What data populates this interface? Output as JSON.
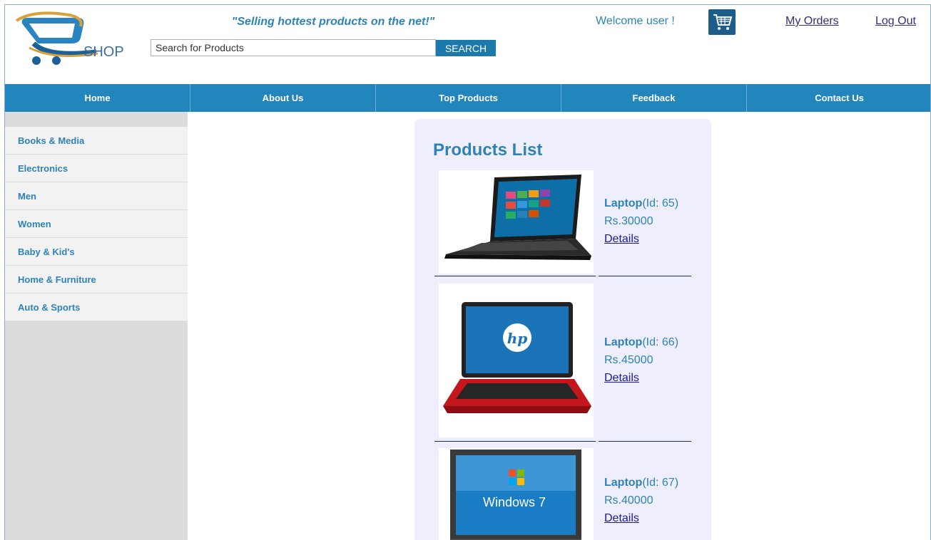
{
  "header": {
    "tagline": "\"Selling hottest products on the net!\"",
    "search_placeholder": "Search for Products",
    "search_button": "SEARCH",
    "welcome": "Welcome user !",
    "my_orders": "My Orders",
    "log_out": "Log Out",
    "logo_icon": "cart-logo-icon",
    "cart_icon": "shopping-cart-icon"
  },
  "nav": {
    "items": [
      "Home",
      "About Us",
      "Top Products",
      "Feedback",
      "Contact Us"
    ]
  },
  "sidebar": {
    "categories": [
      "Books & Media",
      "Electronics",
      "Men",
      "Women",
      "Baby & Kid's",
      "Home & Furniture",
      "Auto & Sports"
    ]
  },
  "products": {
    "title": "Products List",
    "items": [
      {
        "name": "Laptop",
        "id_text": "(Id: 65)",
        "price": "Rs.30000",
        "details": "Details"
      },
      {
        "name": "Laptop",
        "id_text": "(Id: 66)",
        "price": "Rs.45000",
        "details": "Details"
      },
      {
        "name": "Laptop",
        "id_text": "(Id: 67)",
        "price": "Rs.40000",
        "details": "Details"
      }
    ]
  },
  "colors": {
    "accent": "#2285bb",
    "text_blue": "#2e83b6",
    "panel_bg": "#eeeefc",
    "sidebar_bg": "#dcdcdc"
  }
}
